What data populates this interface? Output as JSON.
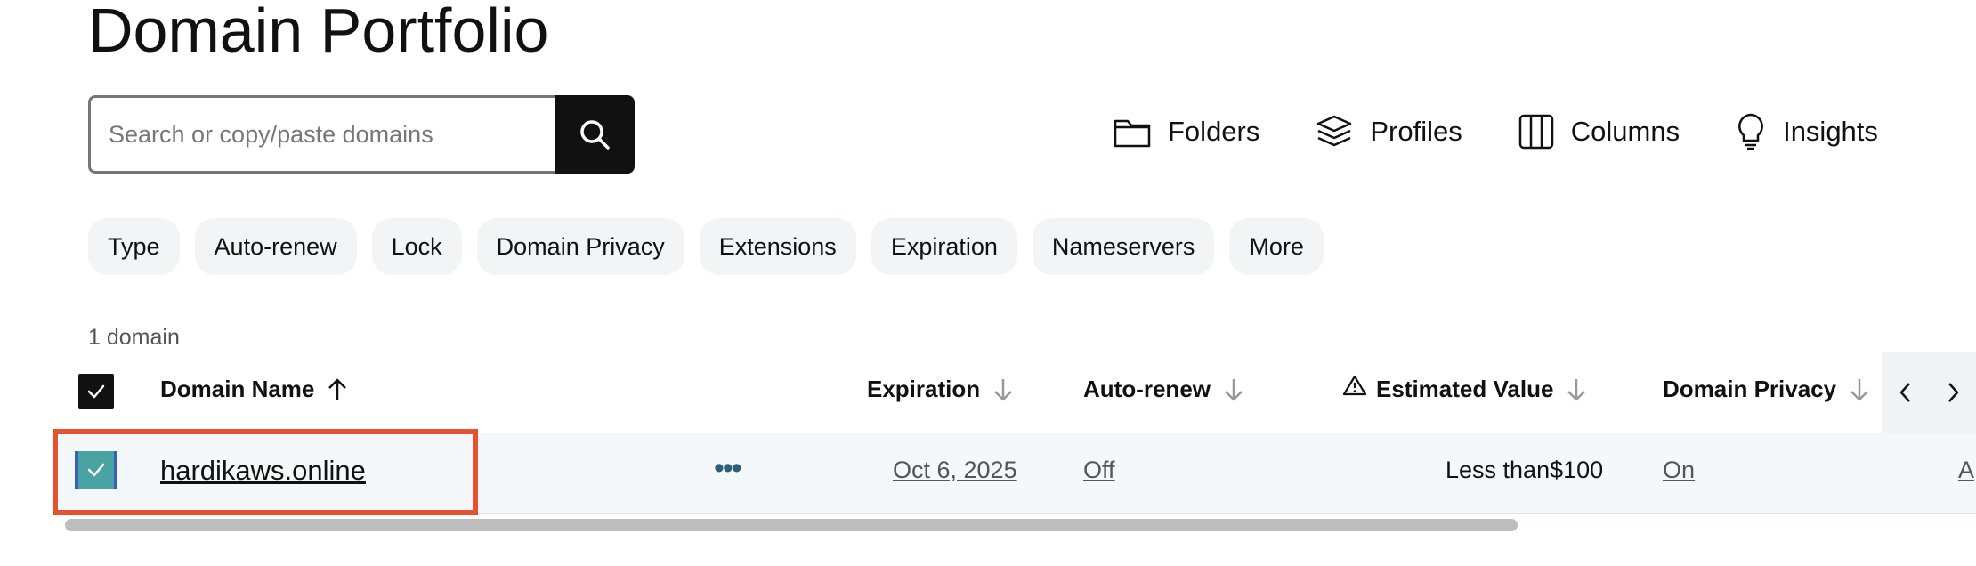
{
  "page": {
    "title": "Domain Portfolio"
  },
  "search": {
    "placeholder": "Search or copy/paste domains"
  },
  "toolbar": {
    "items": [
      {
        "label": "Folders",
        "icon": "folder-icon"
      },
      {
        "label": "Profiles",
        "icon": "layers-icon"
      },
      {
        "label": "Columns",
        "icon": "columns-icon"
      },
      {
        "label": "Insights",
        "icon": "lightbulb-icon"
      }
    ]
  },
  "filters": [
    "Type",
    "Auto-renew",
    "Lock",
    "Domain Privacy",
    "Extensions",
    "Expiration",
    "Nameservers",
    "More"
  ],
  "table": {
    "count_label": "1 domain",
    "columns": {
      "domain_name": "Domain Name",
      "expiration": "Expiration",
      "auto_renew": "Auto-renew",
      "estimated_value": "Estimated Value",
      "domain_privacy": "Domain Privacy"
    },
    "rows": [
      {
        "domain": "hardikaws.online",
        "expiration": "Oct 6, 2025",
        "auto_renew": "Off",
        "estimated_value": "Less than$100",
        "domain_privacy": "On",
        "next_col_partial": "A"
      }
    ]
  },
  "colors": {
    "accent_highlight": "#e8512e",
    "checkbox_selected": "#4aa3a3",
    "search_button": "#111111"
  }
}
